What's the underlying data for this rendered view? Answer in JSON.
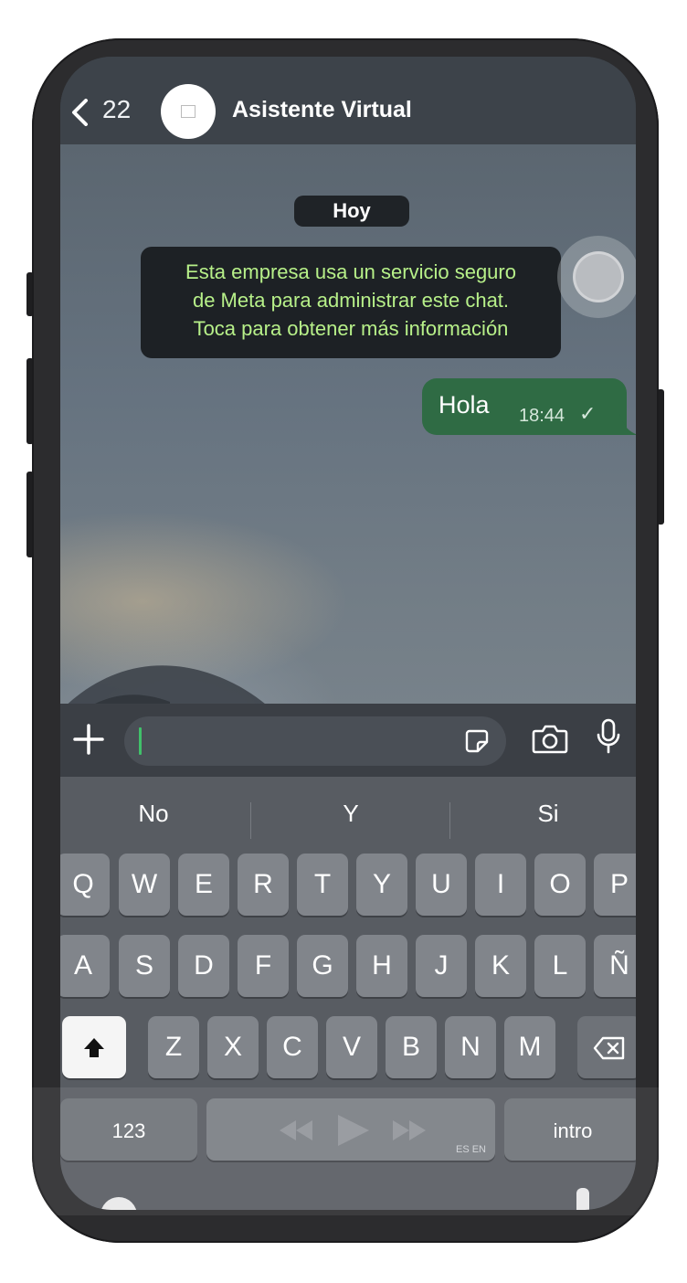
{
  "header": {
    "back_count": "22",
    "contact_name": "Asistente Virtual",
    "back_icon": "chevron-left-icon",
    "avatar_icon": "business-logo"
  },
  "chat": {
    "date_label": "Hoy",
    "system_message_lines": [
      "Esta empresa usa un servicio seguro",
      "de Meta para administrar este chat.",
      "Toca para obtener más información"
    ],
    "messages": [
      {
        "text": "Hola",
        "time": "18:44",
        "status": "✓",
        "direction": "outgoing"
      }
    ]
  },
  "input_bar": {
    "text_value": "",
    "icons": [
      "plus-icon",
      "sticker-icon",
      "camera-icon",
      "microphone-icon"
    ]
  },
  "keyboard": {
    "suggestions": [
      "No",
      "Y",
      "Si"
    ],
    "row1": [
      "Q",
      "W",
      "E",
      "R",
      "T",
      "Y",
      "U",
      "I",
      "O",
      "P"
    ],
    "row2": [
      "A",
      "S",
      "D",
      "F",
      "G",
      "H",
      "J",
      "K",
      "L",
      "Ñ"
    ],
    "row3": [
      "Z",
      "X",
      "C",
      "V",
      "B",
      "N",
      "M"
    ],
    "numbers_key": "123",
    "space_language": "ES EN",
    "return_key": "intro"
  },
  "colors": {
    "outgoing_bubble": "#2f6b44",
    "system_text": "#b7f089",
    "cursor": "#40c06a"
  }
}
